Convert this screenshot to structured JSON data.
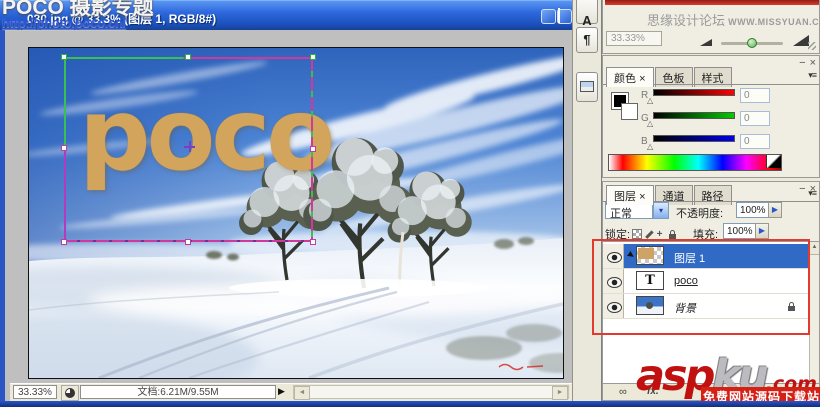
{
  "colors": {
    "selection_blue": "#316AC5",
    "annotation_red": "#E23B2E",
    "poco_gold": "#D2A45C",
    "titlebar_blue": "#2D68DC"
  },
  "watermarks": {
    "poco": {
      "title": "POCO 摄影专题",
      "url": "http://photo.poco.cn/"
    },
    "missyuan": {
      "name": "思缘设计论坛",
      "site": "WWW.MISSYUAN.COM"
    },
    "aspku": {
      "asp": "asp",
      "ku": "ku",
      "tld": ".com",
      "tagline": "免费网站源码下载站!"
    }
  },
  "doc_window": {
    "title": "030.jpg @ 33.3% (图层 1, RGB/8#)",
    "canvas_text": "poco",
    "status": {
      "zoom": "33.33%",
      "doc_info": "文档:6.21M/9.55M"
    }
  },
  "dock": {
    "character_button": "A",
    "paragraph_button": "¶"
  },
  "navigator": {
    "zoom_value": "33.33%"
  },
  "color_panel": {
    "tabs": [
      "颜色",
      "色板",
      "样式"
    ],
    "active_tab_close": "×",
    "channels": [
      {
        "label": "R",
        "value": "0"
      },
      {
        "label": "G",
        "value": "0"
      },
      {
        "label": "B",
        "value": "0"
      }
    ]
  },
  "layers_panel": {
    "tabs": [
      "图层",
      "通道",
      "路径"
    ],
    "active_tab_close": "×",
    "blend_mode": "正常",
    "opacity_label": "不透明度:",
    "opacity_value": "100%",
    "lock_label": "锁定:",
    "fill_label": "填充:",
    "fill_value": "100%",
    "layers": [
      {
        "name": "图层 1"
      },
      {
        "name": "poco"
      },
      {
        "name": "背景"
      }
    ],
    "fx_label": "fx."
  },
  "icons": {
    "panel_minimize": "−",
    "panel_close": "×",
    "menu": "▾≡",
    "combo_arrow": "▾",
    "spinner_arrow": "▶",
    "status_popup": "▶",
    "scroll_left": "◄",
    "scroll_right": "►",
    "scroll_up": "▲",
    "link": "∞",
    "move": "+",
    "slider_thumb": "△",
    "text_thumbnail": "T"
  }
}
